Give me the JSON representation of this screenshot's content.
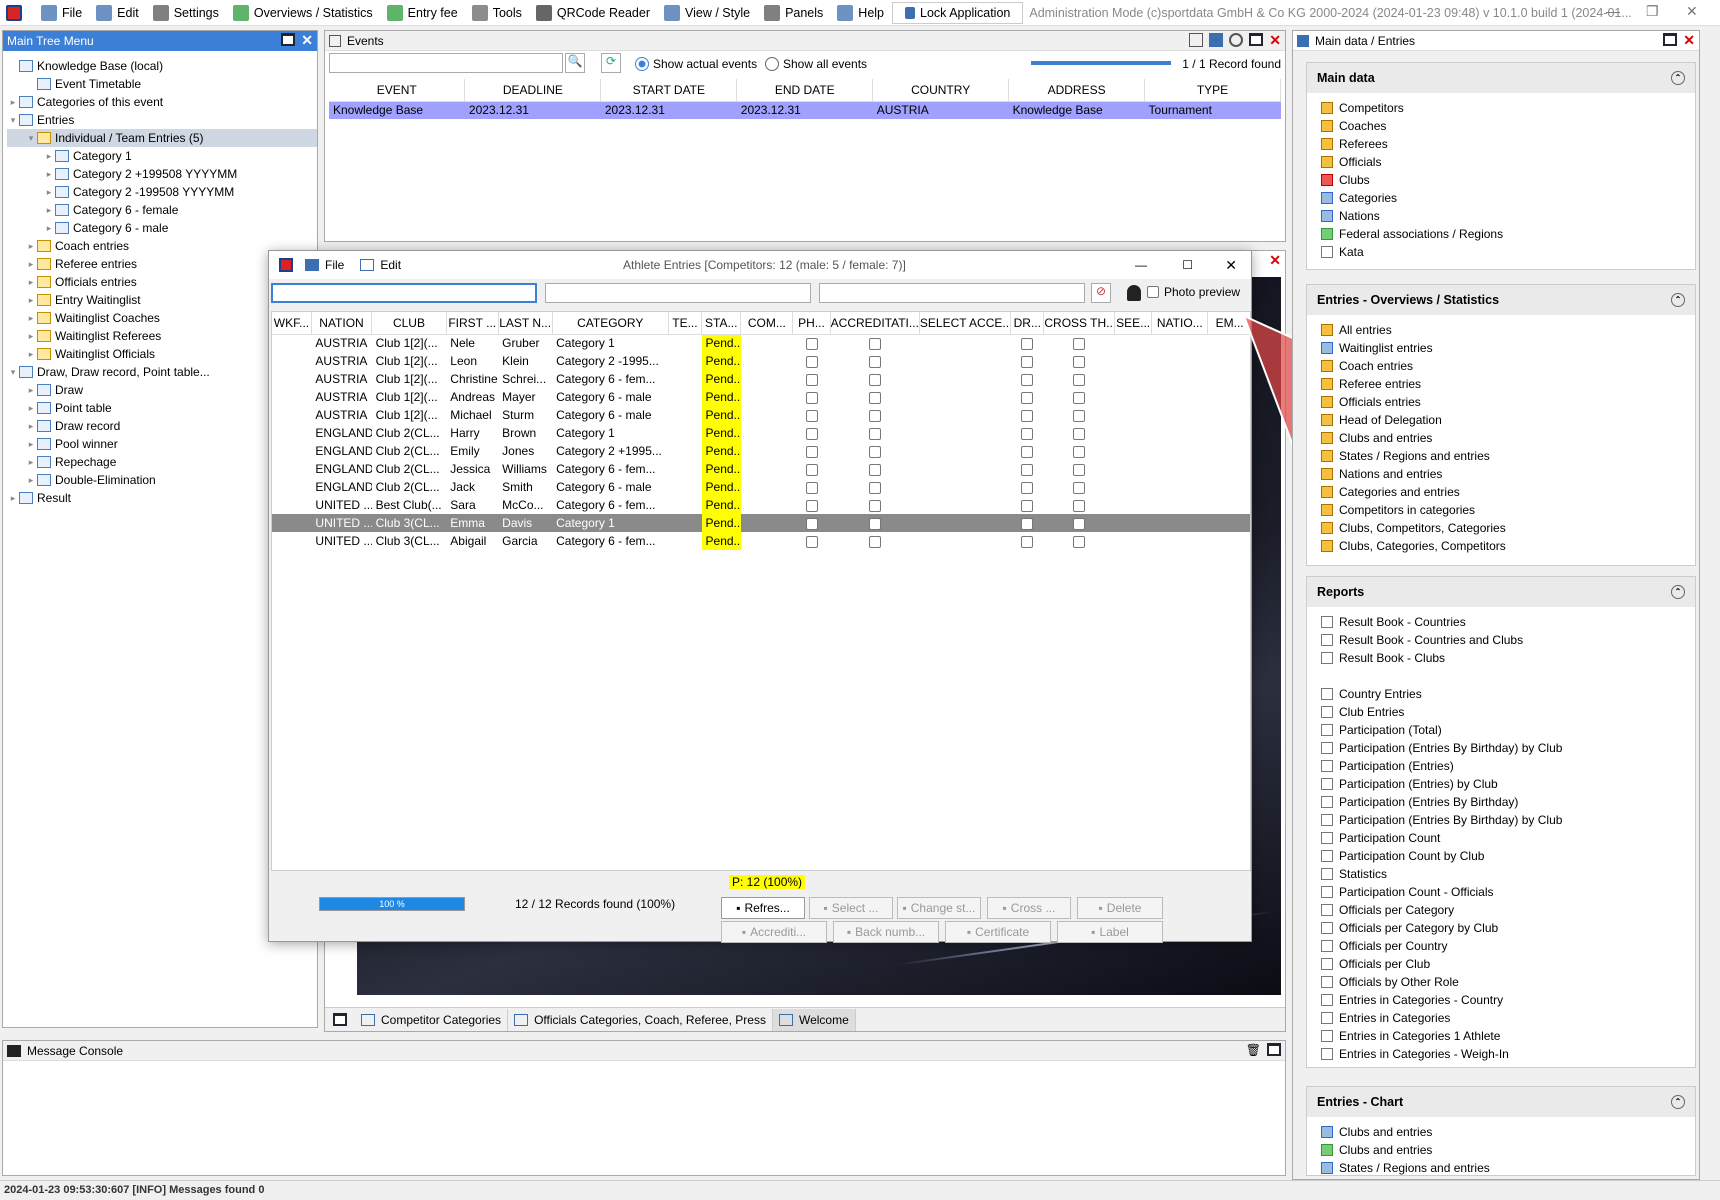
{
  "menubar": {
    "items": [
      {
        "label": "File",
        "icon": "file-icon",
        "color": "#3c6fb0"
      },
      {
        "label": "Edit",
        "icon": "edit-icon",
        "color": "#3c6fb0"
      },
      {
        "label": "Settings",
        "icon": "gear-icon",
        "color": "#555"
      },
      {
        "label": "Overviews / Statistics",
        "icon": "statistics-icon",
        "color": "#2a9a3a"
      },
      {
        "label": "Entry fee",
        "icon": "money-icon",
        "color": "#2a9a3a"
      },
      {
        "label": "Tools",
        "icon": "wrench-icon",
        "color": "#666"
      },
      {
        "label": "QRCode Reader",
        "icon": "qrcode-icon",
        "color": "#333"
      },
      {
        "label": "View / Style",
        "icon": "view-icon",
        "color": "#3c6fb0"
      },
      {
        "label": "Panels",
        "icon": "panels-icon",
        "color": "#555"
      },
      {
        "label": "Help",
        "icon": "help-icon",
        "color": "#3c6fb0"
      }
    ],
    "lock_label": "Lock Application",
    "admin_text": "Administration Mode (c)sportdata GmbH & Co KG 2000-2024 (2024-01-23 09:48)  v 10.1.0 build 1 (2024-01..."
  },
  "tree": {
    "title": "Main Tree Menu",
    "nodes": [
      {
        "label": "Knowledge Base (local)",
        "level": 0,
        "tw": "",
        "icon": "db"
      },
      {
        "label": "Event Timetable",
        "level": 1,
        "tw": "",
        "icon": "clock"
      },
      {
        "label": "Categories of this event",
        "level": 0,
        "tw": "▸",
        "icon": "f"
      },
      {
        "label": "Entries",
        "level": 0,
        "tw": "▾",
        "icon": "f"
      },
      {
        "label": "Individual / Team Entries (5)",
        "level": 1,
        "tw": "▾",
        "icon": "y",
        "sel": true
      },
      {
        "label": "Category 1",
        "level": 2,
        "tw": "▸",
        "icon": "f"
      },
      {
        "label": "Category 2 +199508 YYYYMM",
        "level": 2,
        "tw": "▸",
        "icon": "f"
      },
      {
        "label": "Category 2 -199508 YYYYMM",
        "level": 2,
        "tw": "▸",
        "icon": "f"
      },
      {
        "label": "Category 6 - female",
        "level": 2,
        "tw": "▸",
        "icon": "f"
      },
      {
        "label": "Category 6 - male",
        "level": 2,
        "tw": "▸",
        "icon": "f"
      },
      {
        "label": "Coach entries",
        "level": 1,
        "tw": "▸",
        "icon": "y"
      },
      {
        "label": "Referee entries",
        "level": 1,
        "tw": "▸",
        "icon": "y"
      },
      {
        "label": "Officials entries",
        "level": 1,
        "tw": "▸",
        "icon": "y"
      },
      {
        "label": "Entry Waitinglist",
        "level": 1,
        "tw": "▸",
        "icon": "y"
      },
      {
        "label": "Waitinglist Coaches",
        "level": 1,
        "tw": "▸",
        "icon": "y"
      },
      {
        "label": "Waitinglist Referees",
        "level": 1,
        "tw": "▸",
        "icon": "y"
      },
      {
        "label": "Waitinglist Officials",
        "level": 1,
        "tw": "▸",
        "icon": "y"
      },
      {
        "label": "Draw, Draw record, Point table...",
        "level": 0,
        "tw": "▾",
        "icon": "f"
      },
      {
        "label": "Draw",
        "level": 1,
        "tw": "▸",
        "icon": "f"
      },
      {
        "label": "Point table",
        "level": 1,
        "tw": "▸",
        "icon": "f"
      },
      {
        "label": "Draw record",
        "level": 1,
        "tw": "▸",
        "icon": "f"
      },
      {
        "label": "Pool winner",
        "level": 1,
        "tw": "▸",
        "icon": "f"
      },
      {
        "label": "Repechage",
        "level": 1,
        "tw": "▸",
        "icon": "f"
      },
      {
        "label": "Double-Elimination",
        "level": 1,
        "tw": "▸",
        "icon": "f"
      },
      {
        "label": "Result",
        "level": 0,
        "tw": "▸",
        "icon": "f"
      }
    ]
  },
  "events": {
    "title": "Events",
    "show_actual": "Show actual events",
    "show_all": "Show all events",
    "record_found": "1 / 1 Record found",
    "columns": [
      "EVENT",
      "DEADLINE",
      "START DATE",
      "END DATE",
      "COUNTRY",
      "ADDRESS",
      "TYPE"
    ],
    "rows": [
      [
        "Knowledge Base",
        "2023.12.31",
        "2023.12.31",
        "2023.12.31",
        "AUSTRIA",
        "Knowledge Base",
        "Tournament"
      ]
    ]
  },
  "athletes": {
    "title": "Athlete Entries [Competitors: 12 (male: 5 / female: 7)]",
    "file_label": "File",
    "edit_label": "Edit",
    "photo_preview": "Photo preview",
    "columns": [
      "WKF...",
      "NATION",
      "CLUB",
      "FIRST ...",
      "LAST N...",
      "CATEGORY",
      "TE...",
      "STA...",
      "COM...",
      "PH...",
      "ACCREDITATI...",
      "SELECT ACCE...",
      "DR...",
      "CROSS TH...",
      "SEE...",
      "NATIO...",
      "EM..."
    ],
    "rows": [
      [
        "AUSTRIA",
        "Club 1[2](...",
        "Nele",
        "Gruber",
        "Category 1",
        "Pend..."
      ],
      [
        "AUSTRIA",
        "Club 1[2](...",
        "Leon",
        "Klein",
        "Category 2 -1995...",
        "Pend..."
      ],
      [
        "AUSTRIA",
        "Club 1[2](...",
        "Christine",
        "Schrei...",
        "Category 6 - fem...",
        "Pend..."
      ],
      [
        "AUSTRIA",
        "Club 1[2](...",
        "Andreas",
        "Mayer",
        "Category 6 - male",
        "Pend..."
      ],
      [
        "AUSTRIA",
        "Club 1[2](...",
        "Michael",
        "Sturm",
        "Category 6 - male",
        "Pend..."
      ],
      [
        "ENGLAND",
        "Club 2(CL...",
        "Harry",
        "Brown",
        "Category 1",
        "Pend..."
      ],
      [
        "ENGLAND",
        "Club 2(CL...",
        "Emily",
        "Jones",
        "Category 2 +1995...",
        "Pend..."
      ],
      [
        "ENGLAND",
        "Club 2(CL...",
        "Jessica",
        "Williams",
        "Category 6 - fem...",
        "Pend..."
      ],
      [
        "ENGLAND",
        "Club 2(CL...",
        "Jack",
        "Smith",
        "Category 6 - male",
        "Pend..."
      ],
      [
        "UNITED ...",
        "Best Club(...",
        "Sara",
        "McCo...",
        "Category 6 - fem...",
        "Pend..."
      ],
      [
        "UNITED ...",
        "Club 3(CL...",
        "Emma",
        "Davis",
        "Category 1",
        "Pend..."
      ],
      [
        "UNITED ...",
        "Club 3(CL...",
        "Abigail",
        "Garcia",
        "Category 6 - fem...",
        "Pend..."
      ]
    ],
    "selected_row": 10,
    "status_summary": "P: 12 (100%)",
    "progress_label": "100 %",
    "progress": 1.0,
    "records_found": "12 / 12 Records found (100%)",
    "buttons_row1": [
      "Refres...",
      "Select ...",
      "Change st...",
      "Cross ...",
      "Delete"
    ],
    "buttons_row2": [
      "Accrediti...",
      "Back numb...",
      "Certificate",
      "Label"
    ]
  },
  "bottom_tabs": [
    "Competitor Categories",
    "Officials Categories, Coach, Referee, Press",
    "Welcome"
  ],
  "console": {
    "title": "Message Console"
  },
  "status_bar": "2024-01-23 09:53:30:607 [INFO] Messages found 0",
  "right": {
    "title": "Main data / Entries",
    "sections": [
      {
        "title": "Main data",
        "items": [
          {
            "label": "Competitors",
            "icon": "competitor-icon",
            "c": "y"
          },
          {
            "label": "Coaches",
            "icon": "coach-icon",
            "c": "y"
          },
          {
            "label": "Referees",
            "icon": "referee-icon",
            "c": "y"
          },
          {
            "label": "Officials",
            "icon": "official-icon",
            "c": "y"
          },
          {
            "label": "Clubs",
            "icon": "club-icon",
            "c": "r"
          },
          {
            "label": "Categories",
            "icon": "category-icon",
            "c": "b"
          },
          {
            "label": "Nations",
            "icon": "nation-icon",
            "c": "b"
          },
          {
            "label": "Federal associations / Regions",
            "icon": "region-icon",
            "c": "g"
          },
          {
            "label": "Kata",
            "icon": "kata-icon",
            "c": "doc"
          }
        ]
      },
      {
        "title": "Entries - Overviews / Statistics",
        "items": [
          {
            "label": "All entries",
            "icon": "list-icon",
            "c": "y"
          },
          {
            "label": "Waitinglist entries",
            "icon": "list-icon",
            "c": "b"
          },
          {
            "label": "Coach entries",
            "icon": "list-icon",
            "c": "y"
          },
          {
            "label": "Referee entries",
            "icon": "list-icon",
            "c": "y"
          },
          {
            "label": "Officials entries",
            "icon": "list-icon",
            "c": "y"
          },
          {
            "label": "Head of Delegation",
            "icon": "list-icon",
            "c": "y"
          },
          {
            "label": "Clubs and entries",
            "icon": "list-icon",
            "c": "y"
          },
          {
            "label": "States / Regions and entries",
            "icon": "list-icon",
            "c": "y"
          },
          {
            "label": "Nations and entries",
            "icon": "list-icon",
            "c": "y"
          },
          {
            "label": "Categories and entries",
            "icon": "list-icon",
            "c": "y"
          },
          {
            "label": "Competitors in categories",
            "icon": "list-icon",
            "c": "y"
          },
          {
            "label": "Clubs, Competitors, Categories",
            "icon": "list-icon",
            "c": "y"
          },
          {
            "label": "Clubs, Categories, Competitors",
            "icon": "list-icon",
            "c": "y"
          }
        ]
      },
      {
        "title": "Reports",
        "items": [
          {
            "label": "Result Book - Countries",
            "icon": "report-icon",
            "c": "doc"
          },
          {
            "label": "Result Book - Countries and Clubs",
            "icon": "report-icon",
            "c": "doc"
          },
          {
            "label": "Result Book - Clubs",
            "icon": "report-icon",
            "c": "doc"
          },
          {
            "label": "",
            "icon": "",
            "c": "none"
          },
          {
            "label": "Country Entries",
            "icon": "report-icon",
            "c": "doc"
          },
          {
            "label": "Club Entries",
            "icon": "report-icon",
            "c": "doc"
          },
          {
            "label": "Participation (Total)",
            "icon": "report-icon",
            "c": "doc"
          },
          {
            "label": "Participation (Entries By Birthday) by Club",
            "icon": "report-icon",
            "c": "doc"
          },
          {
            "label": "Participation (Entries)",
            "icon": "report-icon",
            "c": "doc"
          },
          {
            "label": "Participation (Entries) by Club",
            "icon": "report-icon",
            "c": "doc"
          },
          {
            "label": "Participation (Entries By Birthday)",
            "icon": "report-icon",
            "c": "doc"
          },
          {
            "label": "Participation (Entries By Birthday) by Club",
            "icon": "report-icon",
            "c": "doc"
          },
          {
            "label": "Participation Count",
            "icon": "report-icon",
            "c": "doc"
          },
          {
            "label": "Participation Count by Club",
            "icon": "report-icon",
            "c": "doc"
          },
          {
            "label": "Statistics",
            "icon": "report-icon",
            "c": "doc"
          },
          {
            "label": "Participation Count - Officials",
            "icon": "report-icon",
            "c": "doc"
          },
          {
            "label": "Officials per Category",
            "icon": "report-icon",
            "c": "doc"
          },
          {
            "label": "Officials per Category by Club",
            "icon": "report-icon",
            "c": "doc"
          },
          {
            "label": "Officials per Country",
            "icon": "report-icon",
            "c": "doc"
          },
          {
            "label": "Officials per Club",
            "icon": "report-icon",
            "c": "doc"
          },
          {
            "label": "Officials by Other Role",
            "icon": "report-icon",
            "c": "doc"
          },
          {
            "label": "Entries in Categories - Country",
            "icon": "report-icon",
            "c": "doc"
          },
          {
            "label": "Entries in Categories",
            "icon": "report-icon",
            "c": "doc"
          },
          {
            "label": "Entries in Categories 1 Athlete",
            "icon": "report-icon",
            "c": "doc"
          },
          {
            "label": "Entries in Categories - Weigh-In",
            "icon": "report-icon",
            "c": "doc"
          }
        ]
      },
      {
        "title": "Entries - Chart",
        "items": [
          {
            "label": "Clubs and entries",
            "icon": "chart-icon",
            "c": "b"
          },
          {
            "label": "Clubs and entries",
            "icon": "chart-icon",
            "c": "g"
          },
          {
            "label": "States / Regions and entries",
            "icon": "chart-icon",
            "c": "b"
          }
        ]
      }
    ]
  },
  "colors": {
    "accent": "#3c7fd6",
    "selection": "#a0a0ff",
    "status_pending": "#ffff00",
    "arrow": "#e04848"
  }
}
